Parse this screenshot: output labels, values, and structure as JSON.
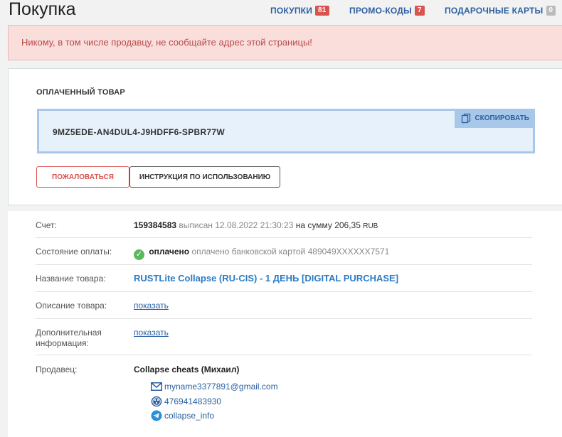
{
  "header": {
    "title": "Покупка",
    "nav": [
      {
        "label": "ПОКУПКИ",
        "badge": "81",
        "badge_color": "#d9534f"
      },
      {
        "label": "ПРОМО-КОДЫ",
        "badge": "7",
        "badge_color": "#d9534f"
      },
      {
        "label": "ПОДАРОЧНЫЕ КАРТЫ",
        "badge": "0",
        "badge_color": "#bbbbbb"
      }
    ]
  },
  "alert": {
    "text": "Никому, в том числе продавцу, не сообщайте адрес этой страницы!"
  },
  "purchase": {
    "title": "ОПЛАЧЕННЫЙ ТОВАР",
    "code": "9MZ5EDE-AN4DUL4-J9HDFF6-SPBR77W",
    "copy_label": "СКОПИРОВАТЬ",
    "complain_label": "ПОЖАЛОВАТЬСЯ",
    "instruction_label": "ИНСТРУКЦИЯ ПО ИСПОЛЬЗОВАНИЮ"
  },
  "details": {
    "invoice": {
      "label": "Счет:",
      "number": "159384583",
      "issued_text": "выписан 12.08.2022 21:30:23",
      "sum_text": "на сумму 206,35",
      "currency": "RUB"
    },
    "payment": {
      "label": "Состояние оплаты:",
      "status": "оплачено",
      "note": "оплачено банковской картой 489049XXXXXX7571"
    },
    "product_name": {
      "label": "Название товара:",
      "value": "RUSTLite Collapse (RU-CIS) - 1 ДЕНЬ [DIGITAL PURCHASE]"
    },
    "description": {
      "label": "Описание товара:",
      "link": "показать"
    },
    "extra_info": {
      "label_line1": "Дополнительная",
      "label_line2": "информация:",
      "link": "показать"
    },
    "seller": {
      "label": "Продавец:",
      "name": "Collapse cheats",
      "person": "(Михаил)",
      "email": "myname3377891@gmail.com",
      "wm": "476941483930",
      "telegram": "collapse_info"
    }
  },
  "colors": {
    "accent": "#2b5fa0",
    "danger": "#d9534f",
    "success": "#5cb85c"
  }
}
